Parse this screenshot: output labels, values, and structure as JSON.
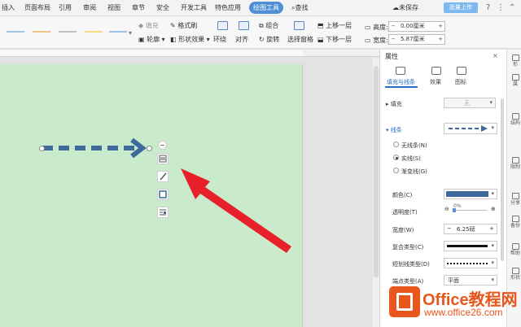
{
  "menu": {
    "items": [
      "插入",
      "页面布局",
      "引用",
      "审阅",
      "视图",
      "章节",
      "安全",
      "开发工具",
      "特色应用",
      "绘图工具"
    ],
    "search": "查找",
    "unsaved": "未保存",
    "upload": "批量上传"
  },
  "ribbon": {
    "fill": "填充",
    "outline": "轮廓",
    "format_painter": "格式刷",
    "shape_effect": "形状效果",
    "wrap": "环绕",
    "align": "对齐",
    "group": "组合",
    "rotate": "旋转",
    "selection_pane": "选择窗格",
    "bring_forward": "上移一层",
    "send_backward": "下移一层",
    "height_label": "高度:",
    "height_value": "0.00厘米",
    "width_label": "宽度:",
    "width_value": "5.87厘米"
  },
  "panel": {
    "title": "属性",
    "tabs": [
      "填充与线条",
      "效果",
      "图标"
    ],
    "fill_label": "填充",
    "fill_value": "无",
    "line_label": "线条",
    "line_options": [
      "无线条(N)",
      "实线(S)",
      "渐变线(G)"
    ],
    "color_label": "颜色(C)",
    "color_value": "#3d6a9b",
    "transparency_label": "透明度(T)",
    "transparency_value": "0%",
    "width_label": "宽度(W)",
    "width_value": "6.25磅",
    "compound_label": "复合类型(C)",
    "dash_label": "短划线类型(D)",
    "cap_label": "端点类型(A)",
    "cap_value": "平面"
  },
  "sidebar": [
    "形",
    "属",
    "结构",
    "限制",
    "分享",
    "备份",
    "帮助",
    "形状"
  ],
  "watermark": {
    "brand": "Office教程网",
    "url": "www.office26.com"
  },
  "colors": {
    "arrow": "#3d6a9b",
    "red_arrow": "#e8202a",
    "page": "#c9ebcb",
    "accent": "#2b6cc4"
  }
}
